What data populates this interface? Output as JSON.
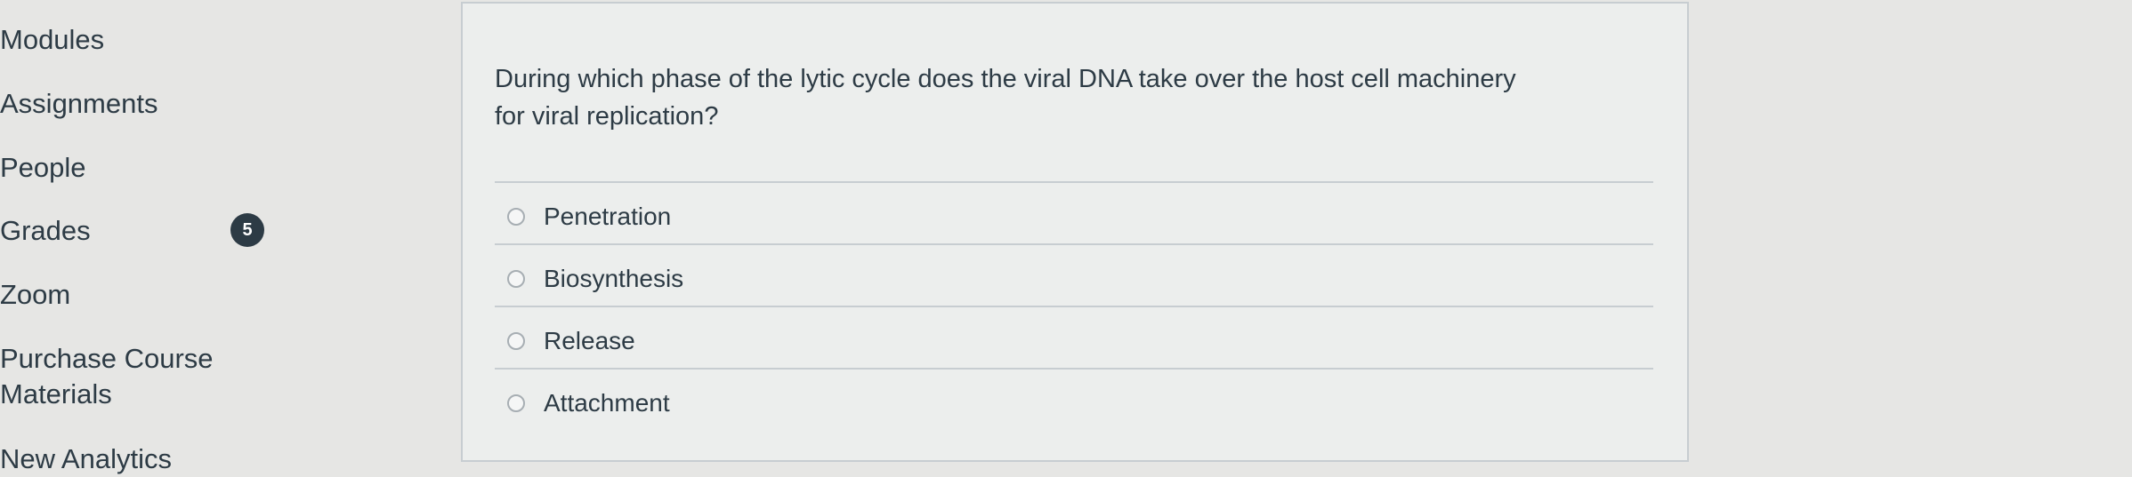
{
  "nav": {
    "items": [
      {
        "label": "Modules"
      },
      {
        "label": "Assignments"
      },
      {
        "label": "People"
      },
      {
        "label": "Grades"
      },
      {
        "label": "Zoom"
      },
      {
        "label": "Purchase Course"
      },
      {
        "label": "Materials"
      },
      {
        "label": "New Analytics"
      }
    ],
    "grades_badge": "5"
  },
  "quiz": {
    "question_line1": "During which phase of the lytic cycle does the viral DNA take over the host cell machinery",
    "question_line2": "for viral replication?",
    "answers": [
      {
        "label": "Penetration",
        "selected": false
      },
      {
        "label": "Biosynthesis",
        "selected": false
      },
      {
        "label": "Release",
        "selected": false
      },
      {
        "label": "Attachment",
        "selected": false
      }
    ]
  }
}
